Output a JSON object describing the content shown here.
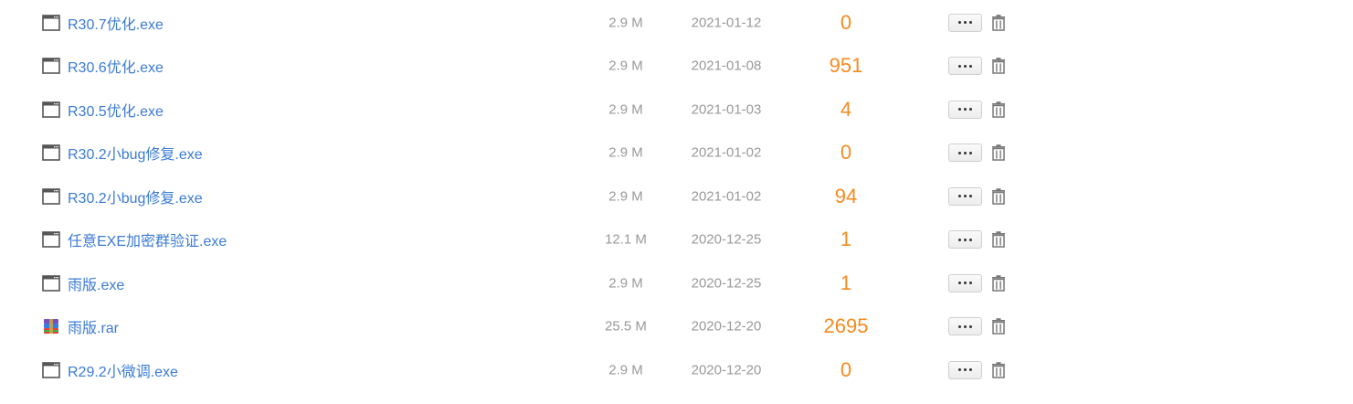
{
  "files": [
    {
      "name": "R30.7优化.exe",
      "type": "exe",
      "icon": "window-file-icon",
      "size": "2.9 M",
      "date": "2021-01-12",
      "count": "0"
    },
    {
      "name": "R30.6优化.exe",
      "type": "exe",
      "icon": "window-file-icon",
      "size": "2.9 M",
      "date": "2021-01-08",
      "count": "951"
    },
    {
      "name": "R30.5优化.exe",
      "type": "exe",
      "icon": "window-file-icon",
      "size": "2.9 M",
      "date": "2021-01-03",
      "count": "4"
    },
    {
      "name": "R30.2小bug修复.exe",
      "type": "exe",
      "icon": "window-file-icon",
      "size": "2.9 M",
      "date": "2021-01-02",
      "count": "0"
    },
    {
      "name": "R30.2小bug修复.exe",
      "type": "exe",
      "icon": "window-file-icon",
      "size": "2.9 M",
      "date": "2021-01-02",
      "count": "94"
    },
    {
      "name": "任意EXE加密群验证.exe",
      "type": "exe",
      "icon": "window-file-icon",
      "size": "12.1 M",
      "date": "2020-12-25",
      "count": "1"
    },
    {
      "name": "雨版.exe",
      "type": "exe",
      "icon": "window-file-icon",
      "size": "2.9 M",
      "date": "2020-12-25",
      "count": "1"
    },
    {
      "name": "雨版.rar",
      "type": "rar",
      "icon": "archive-file-icon",
      "size": "25.5 M",
      "date": "2020-12-20",
      "count": "2695"
    },
    {
      "name": "R29.2小微调.exe",
      "type": "exe",
      "icon": "window-file-icon",
      "size": "2.9 M",
      "date": "2020-12-20",
      "count": "0"
    }
  ],
  "row_actions": {
    "more_icon": "more-dots-icon",
    "delete_icon": "trash-icon"
  },
  "colors": {
    "link": "#3b7bd4",
    "meta": "#999999",
    "count": "#f58a1f"
  }
}
